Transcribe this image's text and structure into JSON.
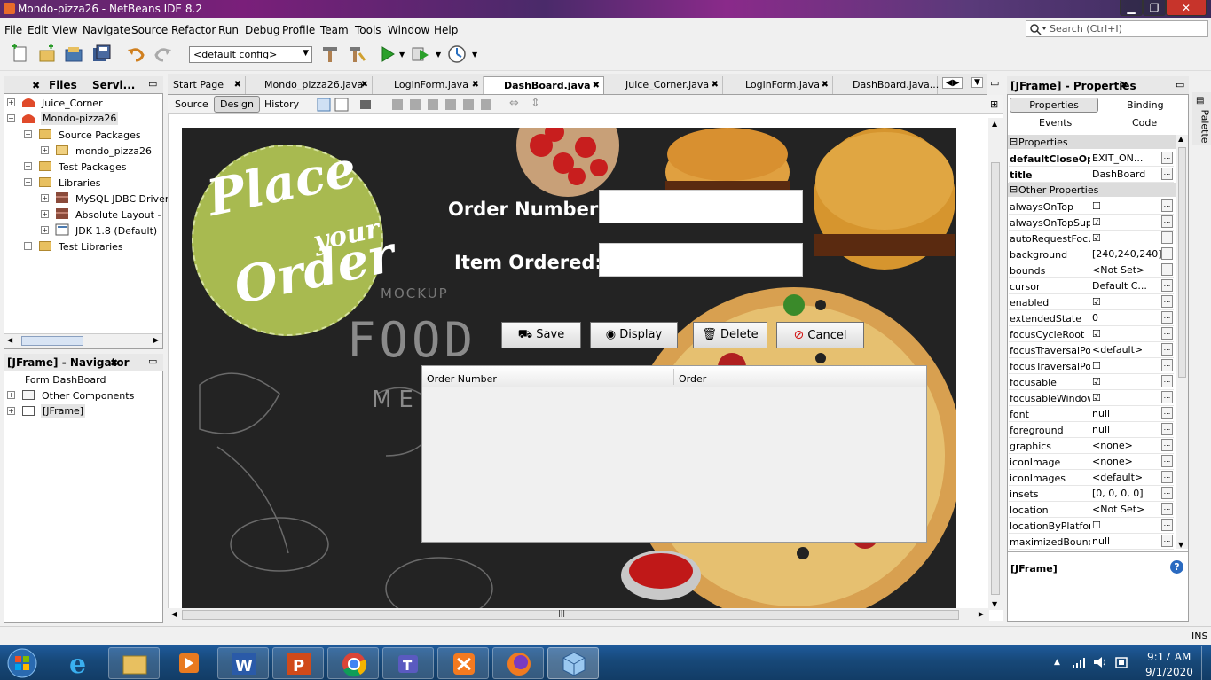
{
  "window": {
    "title": "Mondo-pizza26 - NetBeans IDE 8.2",
    "min": "▁",
    "max": "❐",
    "close": "✕"
  },
  "menu": [
    "File",
    "Edit",
    "View",
    "Navigate",
    "Source",
    "Refactor",
    "Run",
    "Debug",
    "Profile",
    "Team",
    "Tools",
    "Window",
    "Help"
  ],
  "search": {
    "placeholder": "Search (Ctrl+I)"
  },
  "toolbar": {
    "config": "<default config>"
  },
  "projects_panel": {
    "tabs": [
      "Files",
      "Servi..."
    ],
    "items": [
      "Juice_Corner",
      "Mondo-pizza26",
      "Source Packages",
      "mondo_pizza26",
      "Test Packages",
      "Libraries",
      "MySQL JDBC Driver",
      "Absolute Layout - Ab",
      "JDK 1.8 (Default)",
      "Test Libraries"
    ]
  },
  "navigator": {
    "title": "[JFrame] - Navigator",
    "items": [
      "Form DashBoard",
      "Other Components",
      "[JFrame]"
    ]
  },
  "editor_tabs": [
    "Start Page",
    "Mondo_pizza26.java",
    "LoginForm.java",
    "DashBoard.java",
    "Juice_Corner.java",
    "LoginForm.java",
    "DashBoard.java..."
  ],
  "editor_subtabs": [
    "Source",
    "Design",
    "History"
  ],
  "form": {
    "logo_lines": [
      "Place",
      "your",
      "Order"
    ],
    "bg_text": [
      "MOCKUP",
      "FOOD",
      "MENU"
    ],
    "order_number_label": "Order Number:",
    "item_ordered_label": "Item Ordered:",
    "buttons": [
      "Save",
      "Display",
      "Delete",
      "Cancel"
    ],
    "table_columns": [
      "Order Number",
      "Order"
    ]
  },
  "properties": {
    "title": "[JFrame] - Properties",
    "tabs": [
      "Properties",
      "Binding",
      "Events",
      "Code"
    ],
    "section1": "Properties",
    "section2": "Other Properties",
    "rows1": [
      {
        "name": "defaultCloseOpe",
        "value": "EXIT_ON...",
        "bold": true
      },
      {
        "name": "title",
        "value": "DashBoard",
        "bold": true
      }
    ],
    "rows2": [
      {
        "name": "alwaysOnTop",
        "value": "☐"
      },
      {
        "name": "alwaysOnTopSupp",
        "value": "☑"
      },
      {
        "name": "autoRequestFocus",
        "value": "☑"
      },
      {
        "name": "background",
        "value": "[240,240,240]"
      },
      {
        "name": "bounds",
        "value": "<Not Set>"
      },
      {
        "name": "cursor",
        "value": "Default C..."
      },
      {
        "name": "enabled",
        "value": "☑"
      },
      {
        "name": "extendedState",
        "value": "0"
      },
      {
        "name": "focusCycleRoot",
        "value": "☑"
      },
      {
        "name": "focusTraversalPoli",
        "value": "<default>"
      },
      {
        "name": "focusTraversalPoli",
        "value": "☐"
      },
      {
        "name": "focusable",
        "value": "☑"
      },
      {
        "name": "focusableWindowS",
        "value": "☑"
      },
      {
        "name": "font",
        "value": "null"
      },
      {
        "name": "foreground",
        "value": "null"
      },
      {
        "name": "graphics",
        "value": "<none>"
      },
      {
        "name": "iconImage",
        "value": "<none>"
      },
      {
        "name": "iconImages",
        "value": "<default>"
      },
      {
        "name": "insets",
        "value": "[0, 0, 0, 0]"
      },
      {
        "name": "location",
        "value": "<Not Set>"
      },
      {
        "name": "locationByPlatform",
        "value": "☐"
      },
      {
        "name": "maximizedBounds",
        "value": "null"
      }
    ],
    "footer": "[JFrame]",
    "help": "?"
  },
  "palette_label": "Palette",
  "status": {
    "ins": "INS"
  },
  "taskbar": {
    "time": "9:17 AM",
    "date": "9/1/2020"
  }
}
